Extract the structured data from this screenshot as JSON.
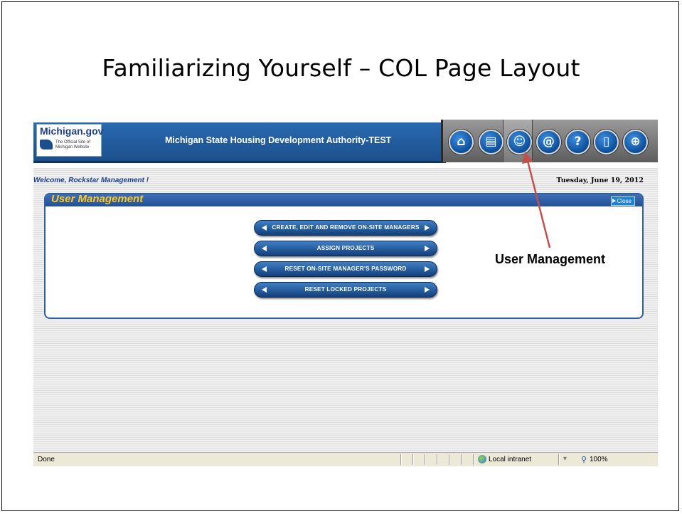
{
  "slide": {
    "title": "Familiarizing Yourself – COL Page Layout",
    "callout": "User Management"
  },
  "header": {
    "logo_title": "Michigan.gov",
    "logo_subtitle": "The Official Site of Michigan Website",
    "agency_title": "Michigan State Housing Development Authority-TEST",
    "nav_icons": [
      "home-icon",
      "document-icon",
      "user-management-icon",
      "email-icon",
      "help-icon",
      "exit-icon",
      "globe-icon"
    ],
    "nav_glyphs": [
      "⌂",
      "▤",
      "☺",
      "@",
      "?",
      "▯",
      "⊕"
    ]
  },
  "welcome": "Welcome, Rockstar Management !",
  "date": "Tuesday, June 19, 2012",
  "panel": {
    "title": "User Management",
    "close_label": "Close",
    "buttons": [
      "CREATE, EDIT AND REMOVE ON-SITE MANAGERS",
      "ASSIGN PROJECTS",
      "RESET ON-SITE MANAGER'S PASSWORD",
      "RESET LOCKED PROJECTS"
    ]
  },
  "statusbar": {
    "status": "Done",
    "zone": "Local intranet",
    "zoom": "100%"
  },
  "colors": {
    "brand_blue": "#1b4f8c",
    "panel_title": "#ffc820",
    "callout_arrow": "#c0504d"
  }
}
